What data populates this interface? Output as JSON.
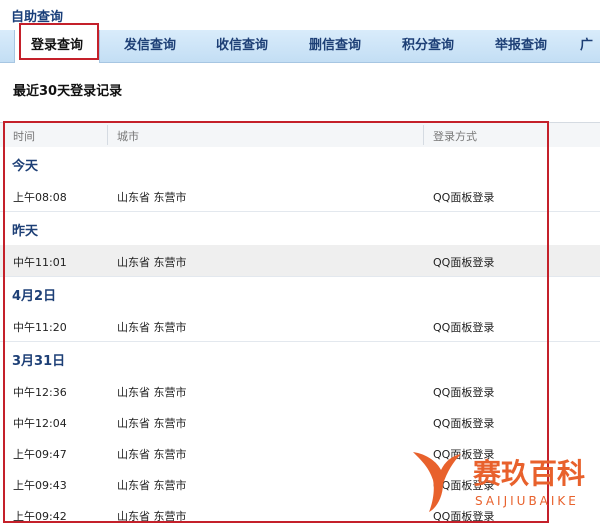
{
  "page": {
    "title": "自助查询"
  },
  "tabs": [
    {
      "label": "登录查询",
      "active": true
    },
    {
      "label": "发信查询"
    },
    {
      "label": "收信查询"
    },
    {
      "label": "删信查询"
    },
    {
      "label": "积分查询"
    },
    {
      "label": "举报查询"
    },
    {
      "label": "广"
    }
  ],
  "section": {
    "title": "最近30天登录记录"
  },
  "table": {
    "headers": [
      "时间",
      "城市",
      "登录方式"
    ],
    "groups": [
      {
        "label": "今天",
        "rows": [
          {
            "time": "上午08:08",
            "city": "山东省 东营市",
            "method": "QQ面板登录"
          }
        ]
      },
      {
        "label": "昨天",
        "rows": [
          {
            "time": "中午11:01",
            "city": "山东省 东营市",
            "method": "QQ面板登录"
          }
        ]
      },
      {
        "label": "4月2日",
        "rows": [
          {
            "time": "中午11:20",
            "city": "山东省 东营市",
            "method": "QQ面板登录"
          }
        ]
      },
      {
        "label": "3月31日",
        "rows": [
          {
            "time": "中午12:36",
            "city": "山东省 东营市",
            "method": "QQ面板登录"
          },
          {
            "time": "中午12:04",
            "city": "山东省 东营市",
            "method": "QQ面板登录"
          },
          {
            "time": "上午09:47",
            "city": "山东省 东营市",
            "method": "QQ面板登录"
          },
          {
            "time": "上午09:43",
            "city": "山东省 东营市",
            "method": "QQ面板登录"
          },
          {
            "time": "上午09:42",
            "city": "山东省 东营市",
            "method": "QQ面板登录"
          }
        ]
      }
    ]
  },
  "watermark": {
    "name": "赛玖百科",
    "pinyin": "SAIJIUBAIKE"
  },
  "colors": {
    "annotation_red": "#c4202a",
    "tab_bg": "#c3def4",
    "link_blue": "#1d3f76",
    "watermark_orange": "#e8612c"
  }
}
